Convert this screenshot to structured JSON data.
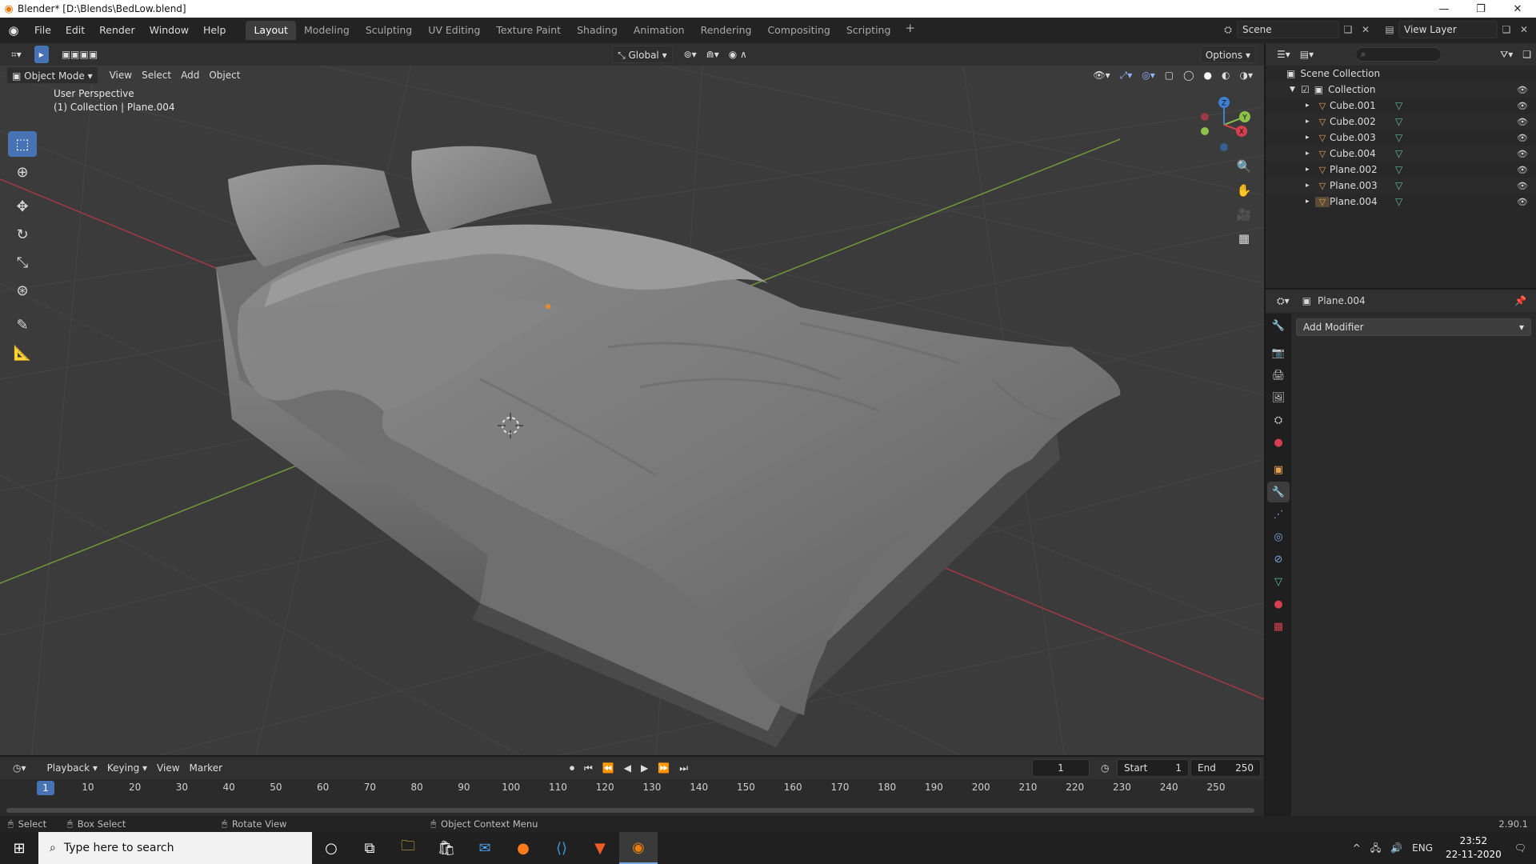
{
  "window": {
    "title": "Blender* [D:\\Blends\\BedLow.blend]",
    "minimize": "—",
    "restore": "❐",
    "close": "✕"
  },
  "menu": [
    "File",
    "Edit",
    "Render",
    "Window",
    "Help"
  ],
  "workspaces": [
    "Layout",
    "Modeling",
    "Sculpting",
    "UV Editing",
    "Texture Paint",
    "Shading",
    "Animation",
    "Rendering",
    "Compositing",
    "Scripting"
  ],
  "active_workspace": "Layout",
  "scene": "Scene",
  "view_layer": "View Layer",
  "viewport": {
    "transform_orientation": "Global",
    "options_label": "Options",
    "mode": "Object Mode",
    "menus": [
      "View",
      "Select",
      "Add",
      "Object"
    ],
    "perspective_label": "User Perspective",
    "context_label": "(1) Collection | Plane.004",
    "gizmo_axes": {
      "x": "X",
      "y": "Y",
      "z": "Z"
    }
  },
  "outliner": {
    "root": "Scene Collection",
    "collection": "Collection",
    "objects": [
      "Cube.001",
      "Cube.002",
      "Cube.003",
      "Cube.004",
      "Plane.002",
      "Plane.003",
      "Plane.004"
    ]
  },
  "properties": {
    "object_name": "Plane.004",
    "add_modifier": "Add Modifier"
  },
  "timeline": {
    "menus": [
      "Playback",
      "Keying",
      "View",
      "Marker"
    ],
    "current_frame": "1",
    "start_label": "Start",
    "start": "1",
    "end_label": "End",
    "end": "250",
    "ticks": [
      "1",
      "10",
      "20",
      "30",
      "40",
      "50",
      "60",
      "70",
      "80",
      "90",
      "100",
      "110",
      "120",
      "130",
      "140",
      "150",
      "160",
      "170",
      "180",
      "190",
      "200",
      "210",
      "220",
      "230",
      "240",
      "250"
    ]
  },
  "statusbar": {
    "select": "Select",
    "box_select": "Box Select",
    "rotate_view": "Rotate View",
    "context_menu": "Object Context Menu",
    "version": "2.90.1"
  },
  "taskbar": {
    "search_placeholder": "Type here to search",
    "lang": "ENG",
    "time": "23:52",
    "date": "22-11-2020"
  },
  "colors": {
    "accent": "#4772b3",
    "x_axis": "#d6404e",
    "y_axis": "#8bc34a",
    "z_axis": "#3f7fd6",
    "object_orange": "#e8a04a",
    "mesh_green": "#5fc28f"
  }
}
